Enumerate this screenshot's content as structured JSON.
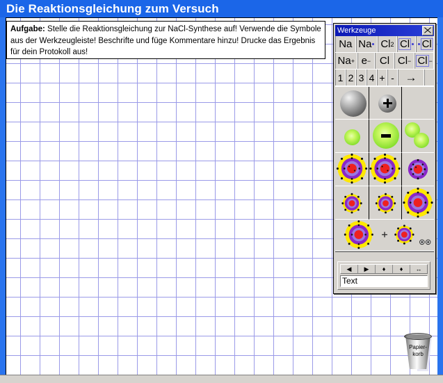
{
  "window": {
    "title": "Die Reaktionsgleichung zum Versuch"
  },
  "task": {
    "label": "Aufgabe:",
    "text": " Stelle die Reaktionsgleichung zur NaCl-Synthese auf!  Verwende die Symbole aus der Werkzeugleiste!  Beschrifte und füge Kommentare hinzu! Drucke das Ergebnis für dein Protokoll aus!"
  },
  "palette": {
    "title": "Werkzeuge",
    "close_label": "×",
    "symbol_rows": [
      {
        "row": 1,
        "buttons": [
          {
            "name": "sodium-atom",
            "text": "Na",
            "kind": "plain"
          },
          {
            "name": "sodium-lewis-one-dot",
            "text": "Na",
            "kind": "dot-right"
          },
          {
            "name": "chlorine-molecule",
            "text": "Cl",
            "sub": "2",
            "kind": "subscript"
          },
          {
            "name": "chlorine-lewis-left",
            "text": "Cl",
            "kind": "lewis-dot-right"
          },
          {
            "name": "chlorine-lewis-right",
            "text": "Cl",
            "kind": "lewis-dot-left"
          }
        ]
      },
      {
        "row": 2,
        "buttons": [
          {
            "name": "sodium-cation",
            "text": "Na",
            "sup": "+",
            "kind": "superscript"
          },
          {
            "name": "electron",
            "text": "e",
            "sup": "−",
            "kind": "superscript"
          },
          {
            "name": "chlorine-atom",
            "text": "Cl",
            "kind": "plain"
          },
          {
            "name": "chloride-anion",
            "text": "Cl",
            "sup": "−",
            "kind": "superscript"
          },
          {
            "name": "chloride-lewis-anion",
            "text": "Cl",
            "sup": "−",
            "kind": "lewis-superscript"
          }
        ]
      },
      {
        "row": 3,
        "buttons": [
          {
            "name": "coefficient-1",
            "text": "1",
            "kind": "plain"
          },
          {
            "name": "coefficient-2",
            "text": "2",
            "kind": "plain"
          },
          {
            "name": "coefficient-3",
            "text": "3",
            "kind": "plain"
          },
          {
            "name": "coefficient-4",
            "text": "4",
            "kind": "plain"
          },
          {
            "name": "plus-sign",
            "text": "+",
            "kind": "plain"
          },
          {
            "name": "minus-sign",
            "text": "-",
            "kind": "plain"
          },
          {
            "name": "reaction-arrow",
            "text": "→",
            "kind": "arrow"
          }
        ]
      }
    ],
    "picture_tools": [
      {
        "name": "grey-sphere-large",
        "label": "Natrium-Atom (Kugel)"
      },
      {
        "name": "grey-sphere-plus",
        "label": "Natrium-Ion (Kugel, positiv)"
      },
      {
        "name": "green-sphere-small",
        "label": "Chlor-Atom (Kugel, klein)"
      },
      {
        "name": "green-sphere-minus",
        "label": "Chlorid-Ion (Kugel, negativ)"
      },
      {
        "name": "green-sphere-pair",
        "label": "Chlor-Molekül (zwei Kugeln)"
      },
      {
        "name": "bohr-atom-large-a",
        "label": "Schalenmodell gross"
      },
      {
        "name": "bohr-atom-large-b",
        "label": "Schalenmodell gross"
      },
      {
        "name": "bohr-atom-medium",
        "label": "Schalenmodell mittel"
      },
      {
        "name": "bohr-atom-small-a",
        "label": "Schalenmodell klein"
      },
      {
        "name": "bohr-atom-small-b",
        "label": "Schalenmodell klein"
      },
      {
        "name": "bohr-atom-ion",
        "label": "Schalenmodell Ion"
      },
      {
        "name": "bohr-reaction-scene",
        "label": "Reaktionsszene"
      }
    ],
    "nav_buttons": [
      {
        "name": "nav-left",
        "glyph": "◀"
      },
      {
        "name": "nav-right",
        "glyph": "▶"
      },
      {
        "name": "nav-down",
        "glyph": "♦"
      },
      {
        "name": "nav-up",
        "glyph": "♦"
      },
      {
        "name": "nav-resize",
        "glyph": "↔"
      }
    ],
    "text_field": {
      "value": "Text",
      "placeholder": "Text"
    }
  },
  "desktop": {
    "recycle_bin": {
      "line1": "Papier-",
      "line2": "korb"
    }
  },
  "colors": {
    "title_bar": "#1b66e8",
    "page_edge": "#2a74ee",
    "grid_line": "#9a9ae8",
    "palette_face": "#d6d3ce",
    "palette_title": "#0c19b5",
    "accent_green": "#8ae030",
    "shell_yellow": "#ffe800",
    "shell_purple": "#8a28c8",
    "nucleus_red": "#ee2020"
  }
}
